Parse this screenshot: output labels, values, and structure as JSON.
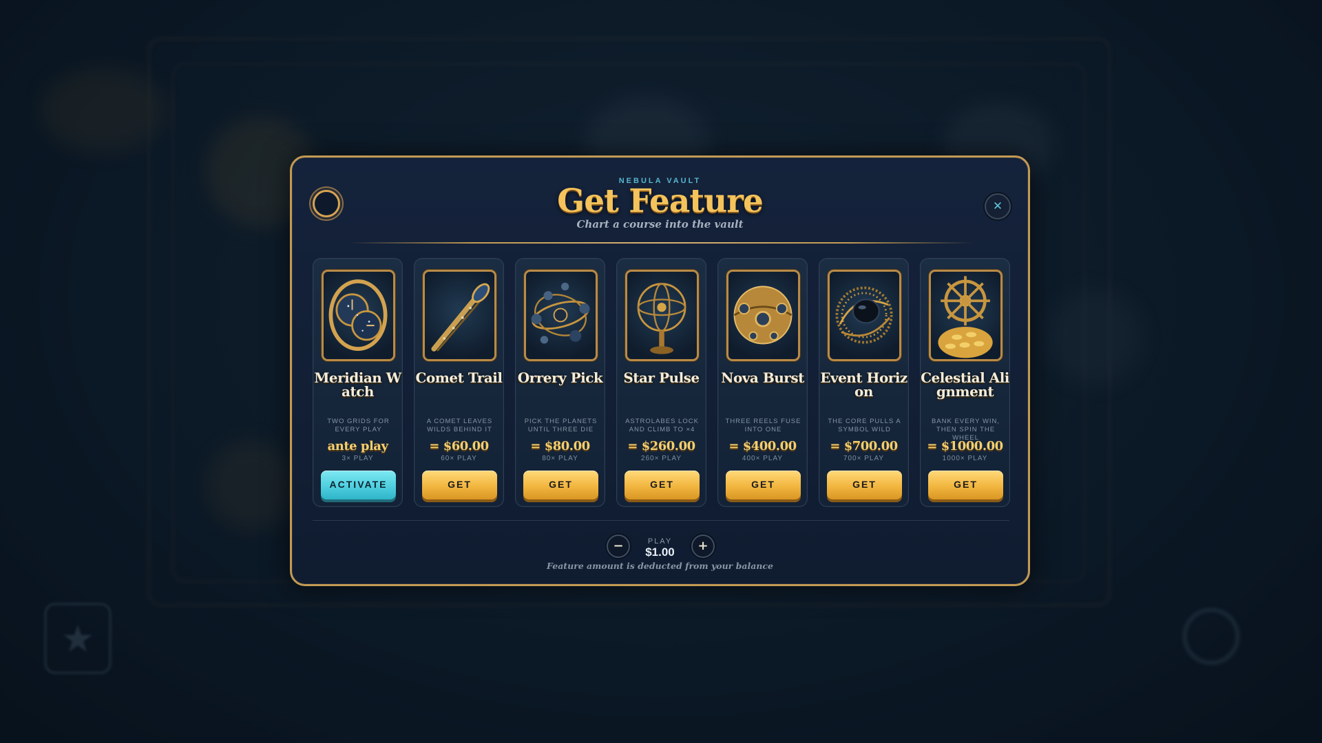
{
  "header": {
    "kicker": "NEBULA VAULT",
    "title": "Get Feature",
    "subtitle": "Chart a course into the vault"
  },
  "features": [
    {
      "name": "Meridian Watch",
      "description": "TWO GRIDS FOR EVERY PLAY",
      "price": "ante play",
      "multiplier": "3× PLAY",
      "button_label": "ACTIVATE",
      "art_icon": "dual-clock-icon"
    },
    {
      "name": "Comet Trail",
      "description": "A COMET LEAVES WILDS BEHIND IT",
      "price": "= $60.00",
      "multiplier": "60× PLAY",
      "button_label": "GET",
      "art_icon": "comet-icon"
    },
    {
      "name": "Orrery Pick",
      "description": "PICK THE PLANETS UNTIL THREE DIE",
      "price": "= $80.00",
      "multiplier": "80× PLAY",
      "button_label": "GET",
      "art_icon": "orrery-icon"
    },
    {
      "name": "Star Pulse",
      "description": "ASTROLABES LOCK AND CLIMB TO ×4",
      "price": "= $260.00",
      "multiplier": "260× PLAY",
      "button_label": "GET",
      "art_icon": "armillary-sphere-icon"
    },
    {
      "name": "Nova Burst",
      "description": "THREE REELS FUSE INTO ONE",
      "price": "= $400.00",
      "multiplier": "400× PLAY",
      "button_label": "GET",
      "art_icon": "orb-icon"
    },
    {
      "name": "Event Horizon",
      "description": "THE CORE PULLS A SYMBOL WILD",
      "price": "= $700.00",
      "multiplier": "700× PLAY",
      "button_label": "GET",
      "art_icon": "black-hole-icon"
    },
    {
      "name": "Celestial Alignment",
      "description": "BANK EVERY WIN, THEN SPIN THE WHEEL",
      "price": "= $1000.00",
      "multiplier": "1000× PLAY",
      "button_label": "GET",
      "art_icon": "ship-wheel-coins-icon"
    }
  ],
  "stake": {
    "decrease_label": "−",
    "increase_label": "+",
    "label": "PLAY",
    "value": "$1.00"
  },
  "footnote": "Feature amount is deducted from your balance",
  "close_label": "✕",
  "colors": {
    "accent_gold": "#f4c35c",
    "frame_gold": "#c49a52",
    "activate_cyan": "#4fcfe0",
    "modal_bg": "#13213a"
  }
}
